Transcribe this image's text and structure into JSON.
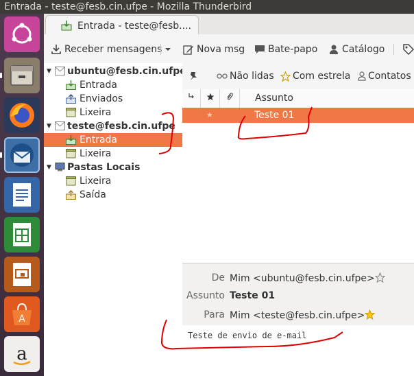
{
  "window": {
    "title": "Entrada - teste@fesb.cin.ufpe - Mozilla Thunderbird"
  },
  "launcher": {
    "items": [
      "ubuntu-dash-icon",
      "files-icon",
      "firefox-icon",
      "thunderbird-icon",
      "writer-icon",
      "calc-icon",
      "impress-icon",
      "software-center-icon",
      "amazon-icon"
    ]
  },
  "tab": {
    "label": "Entrada - teste@fesb...."
  },
  "toolbar": {
    "get_messages": "Receber mensagens",
    "write": "Nova msg",
    "chat": "Bate-papo",
    "address_book": "Catálogo"
  },
  "folders": {
    "account1": "ubuntu@fesb.cin.ufpe",
    "account1_inbox": "Entrada",
    "account1_sent": "Enviados",
    "account1_trash": "Lixeira",
    "account2": "teste@fesb.cin.ufpe",
    "account2_inbox": "Entrada",
    "account2_trash": "Lixeira",
    "local": "Pastas Locais",
    "local_trash": "Lixeira",
    "local_outbox": "Saída"
  },
  "quickfilter": {
    "unread": "Não lidas",
    "starred": "Com estrela",
    "contacts": "Contatos"
  },
  "thread": {
    "col_subject": "Assunto",
    "rows": [
      {
        "subject": "Teste 01"
      }
    ]
  },
  "message": {
    "from_label": "De",
    "from_value": "Mim <ubuntu@fesb.cin.ufpe>",
    "subject_label": "Assunto",
    "subject_value": "Teste 01",
    "to_label": "Para",
    "to_value": "Mim <teste@fesb.cin.ufpe>",
    "body": "Teste de envio de e-mail"
  },
  "colors": {
    "selection": "#f07746",
    "ink": "#e00000"
  }
}
